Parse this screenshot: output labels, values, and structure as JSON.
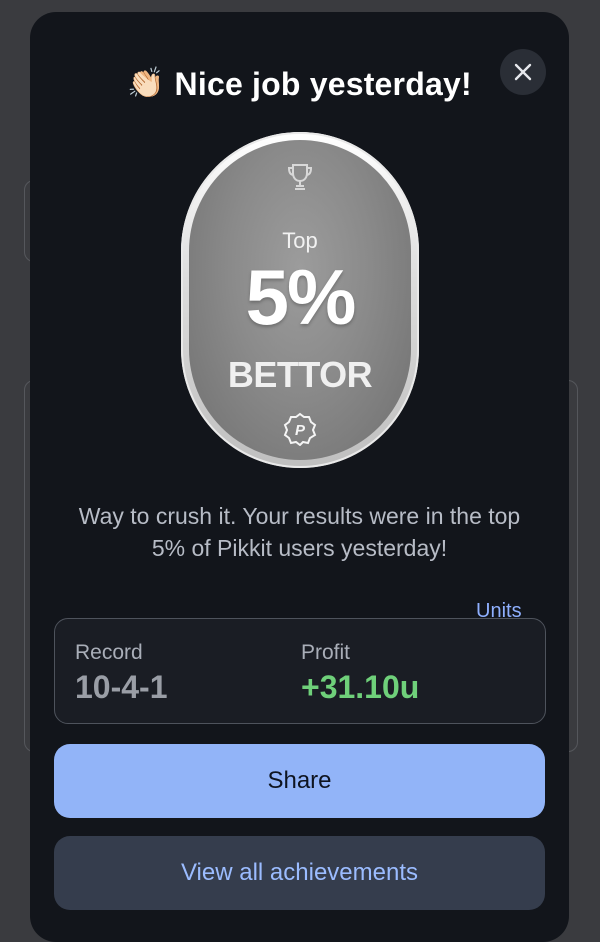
{
  "modal": {
    "title_emoji": "👏🏻",
    "title": "Nice job yesterday!",
    "close_icon": "close-icon"
  },
  "badge": {
    "top_label": "Top",
    "percent": "5%",
    "bettor_label": "BETTOR",
    "trophy_icon": "trophy-icon",
    "logo_icon": "pikkit-logo-icon",
    "logo_letter": "P"
  },
  "description": "Way to crush it. Your results were in the top 5% of Pikkit users yesterday!",
  "units_toggle": "Units",
  "stats": {
    "record_label": "Record",
    "record_value": "10-4-1",
    "profit_label": "Profit",
    "profit_value": "+31.10u"
  },
  "buttons": {
    "share": "Share",
    "view_all": "View all achievements"
  },
  "colors": {
    "accent_blue": "#92b4f8",
    "profit_green": "#6fd07a",
    "modal_bg": "#12151b"
  }
}
